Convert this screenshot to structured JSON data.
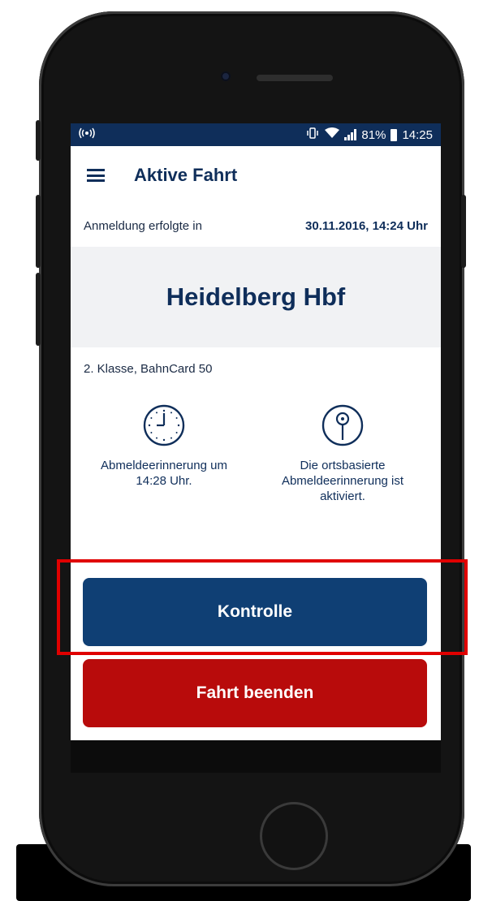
{
  "status_bar": {
    "battery_percent": "81%",
    "time": "14:25",
    "icons": [
      "nfc-icon",
      "vibrate-icon",
      "wifi-icon",
      "signal-icon",
      "battery-icon"
    ]
  },
  "app_bar": {
    "title": "Aktive Fahrt",
    "menu_icon": "menu-icon"
  },
  "login": {
    "label": "Anmeldung erfolgte in",
    "datetime": "30.11.2016, 14:24 Uhr"
  },
  "station": {
    "name": "Heidelberg Hbf"
  },
  "ticket": {
    "info": "2. Klasse, BahnCard 50"
  },
  "reminders": [
    {
      "icon": "clock-icon",
      "text": "Abmeldeerinnerung um 14:28 Uhr."
    },
    {
      "icon": "location-pin-icon",
      "text": "Die ortsbasierte Abmeldeerinnerung ist aktiviert."
    }
  ],
  "buttons": {
    "kontrolle": "Kontrolle",
    "beenden": "Fahrt beenden"
  },
  "colors": {
    "primary": "#0f3f74",
    "danger": "#b80b0b",
    "highlight": "#e00000",
    "statusbar": "#0f2e5a"
  }
}
